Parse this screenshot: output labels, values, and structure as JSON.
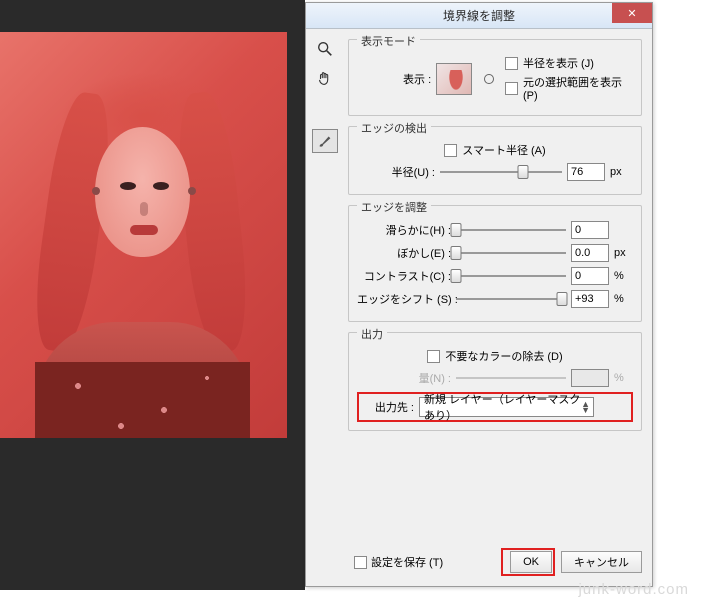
{
  "dialog_title": "境界線を調整",
  "tools": [
    "zoom",
    "hand",
    "brush"
  ],
  "display_mode": {
    "group_label": "表示モード",
    "show_label": "表示 :",
    "show_radius": {
      "label": "半径を表示 (J)",
      "checked": false
    },
    "show_original": {
      "label": "元の選択範囲を表示 (P)",
      "checked": false
    }
  },
  "edge_detect": {
    "group_label": "エッジの検出",
    "smart_radius": {
      "label": "スマート半径 (A)",
      "checked": false
    },
    "radius": {
      "label": "半径(U) :",
      "value": "76",
      "unit": "px",
      "pct": 68
    }
  },
  "edge_adjust": {
    "group_label": "エッジを調整",
    "smooth": {
      "label": "滑らかに(H) :",
      "value": "0",
      "unit": "",
      "pct": 0
    },
    "feather": {
      "label": "ぼかし(E) :",
      "value": "0.0",
      "unit": "px",
      "pct": 0
    },
    "contrast": {
      "label": "コントラスト(C) :",
      "value": "0",
      "unit": "%",
      "pct": 0
    },
    "shift": {
      "label": "エッジをシフト (S) :",
      "value": "+93",
      "unit": "%",
      "pct": 96
    }
  },
  "output": {
    "group_label": "出力",
    "decontaminate": {
      "label": "不要なカラーの除去 (D)",
      "checked": false
    },
    "amount": {
      "label": "量(N) :",
      "value": "",
      "unit": "%",
      "disabled": true,
      "pct": 50
    },
    "output_to_label": "出力先 :",
    "output_to_value": "新規 レイヤー（レイヤーマスクあり）"
  },
  "save_settings": {
    "label": "設定を保存 (T)",
    "checked": false
  },
  "buttons": {
    "ok": "OK",
    "cancel": "キャンセル"
  },
  "watermark": "junk-word.com"
}
